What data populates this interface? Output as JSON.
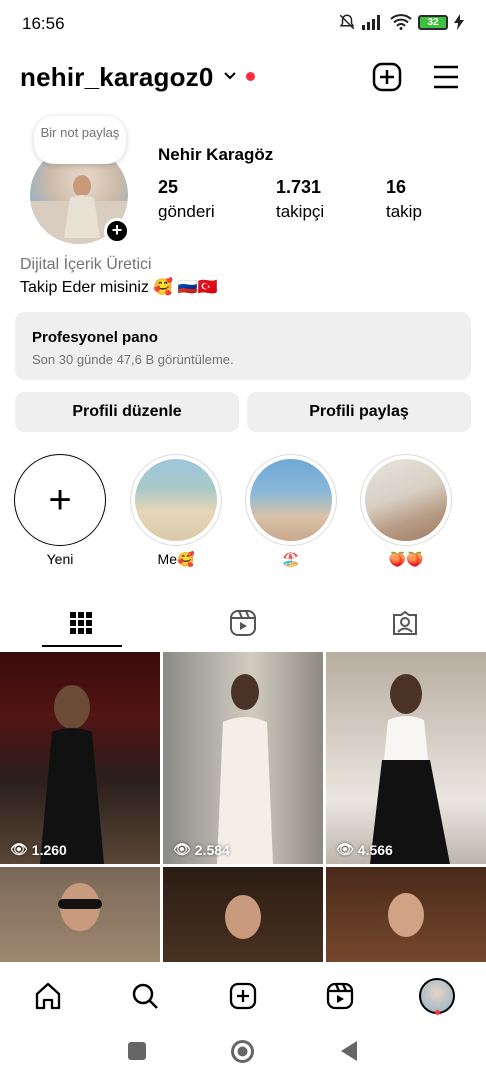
{
  "status": {
    "time": "16:56",
    "battery": "32"
  },
  "header": {
    "username": "nehir_karagoz0"
  },
  "profile": {
    "note": "Bir not paylaş",
    "display_name": "Nehir Karagöz",
    "stats": [
      {
        "num": "25",
        "label": "gönderi"
      },
      {
        "num": "1.731",
        "label": "takipçi"
      },
      {
        "num": "16",
        "label": "takip"
      }
    ],
    "category": "Dijital İçerik Üretici",
    "bio": "Takip Eder misiniz 🥰 🇷🇺🇹🇷"
  },
  "pro_panel": {
    "title": "Profesyonel pano",
    "subtitle": "Son 30 günde 47,6 B görüntüleme."
  },
  "buttons": {
    "edit": "Profili düzenle",
    "share": "Profili paylaş"
  },
  "highlights": [
    {
      "label": "Yeni",
      "icon": "plus-icon"
    },
    {
      "label": "Me🥰"
    },
    {
      "label": "🏖️"
    },
    {
      "label": "🍑🍑"
    }
  ],
  "posts": [
    {
      "views": "1.260"
    },
    {
      "views": "2.584"
    },
    {
      "views": "4.566"
    },
    {
      "views": ""
    },
    {
      "views": ""
    },
    {
      "views": ""
    }
  ],
  "icons": {
    "header": [
      "chevron-down-icon",
      "add-post-icon",
      "menu-icon"
    ],
    "tabs": [
      "grid-icon",
      "reels-icon",
      "tagged-icon"
    ],
    "nav": [
      "home-icon",
      "search-icon",
      "create-icon",
      "reels-icon",
      "profile-avatar"
    ],
    "system": [
      "recents-icon",
      "home-circle-icon",
      "back-icon"
    ]
  },
  "colors": {
    "accent_red": "#ff2d3b",
    "panel_bg": "#efefef",
    "muted_text": "#737373"
  }
}
